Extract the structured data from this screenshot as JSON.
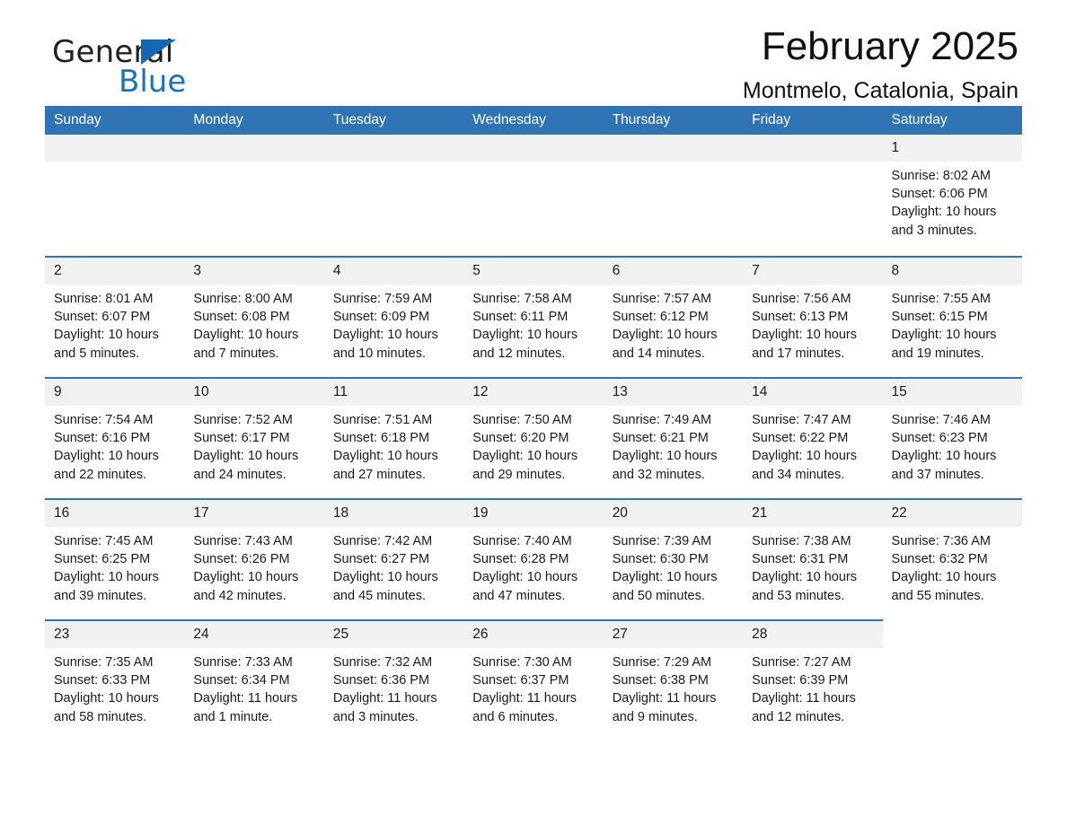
{
  "brand": {
    "name_part1": "General",
    "name_part2": "Blue"
  },
  "header": {
    "month_title": "February 2025",
    "location": "Montmelo, Catalonia, Spain"
  },
  "colors": {
    "header_blue": "#3174b6",
    "row_rule_blue": "#3174b6",
    "daynum_band": "#f1f1f1",
    "logo_blue": "#1473c4",
    "text": "#1a1a1a",
    "page_background": "#ffffff"
  },
  "calendar": {
    "weekday_headers": [
      "Sunday",
      "Monday",
      "Tuesday",
      "Wednesday",
      "Thursday",
      "Friday",
      "Saturday"
    ],
    "labels": {
      "sunrise_prefix": "Sunrise:",
      "sunset_prefix": "Sunset:",
      "daylight_prefix": "Daylight:"
    },
    "weeks": [
      [
        {
          "day": "",
          "empty": true
        },
        {
          "day": "",
          "empty": true
        },
        {
          "day": "",
          "empty": true
        },
        {
          "day": "",
          "empty": true
        },
        {
          "day": "",
          "empty": true
        },
        {
          "day": "",
          "empty": true
        },
        {
          "day": "1",
          "sunrise": "Sunrise: 8:02 AM",
          "sunset": "Sunset: 6:06 PM",
          "daylight": "Daylight: 10 hours and 3 minutes."
        }
      ],
      [
        {
          "day": "2",
          "sunrise": "Sunrise: 8:01 AM",
          "sunset": "Sunset: 6:07 PM",
          "daylight": "Daylight: 10 hours and 5 minutes."
        },
        {
          "day": "3",
          "sunrise": "Sunrise: 8:00 AM",
          "sunset": "Sunset: 6:08 PM",
          "daylight": "Daylight: 10 hours and 7 minutes."
        },
        {
          "day": "4",
          "sunrise": "Sunrise: 7:59 AM",
          "sunset": "Sunset: 6:09 PM",
          "daylight": "Daylight: 10 hours and 10 minutes."
        },
        {
          "day": "5",
          "sunrise": "Sunrise: 7:58 AM",
          "sunset": "Sunset: 6:11 PM",
          "daylight": "Daylight: 10 hours and 12 minutes."
        },
        {
          "day": "6",
          "sunrise": "Sunrise: 7:57 AM",
          "sunset": "Sunset: 6:12 PM",
          "daylight": "Daylight: 10 hours and 14 minutes."
        },
        {
          "day": "7",
          "sunrise": "Sunrise: 7:56 AM",
          "sunset": "Sunset: 6:13 PM",
          "daylight": "Daylight: 10 hours and 17 minutes."
        },
        {
          "day": "8",
          "sunrise": "Sunrise: 7:55 AM",
          "sunset": "Sunset: 6:15 PM",
          "daylight": "Daylight: 10 hours and 19 minutes."
        }
      ],
      [
        {
          "day": "9",
          "sunrise": "Sunrise: 7:54 AM",
          "sunset": "Sunset: 6:16 PM",
          "daylight": "Daylight: 10 hours and 22 minutes."
        },
        {
          "day": "10",
          "sunrise": "Sunrise: 7:52 AM",
          "sunset": "Sunset: 6:17 PM",
          "daylight": "Daylight: 10 hours and 24 minutes."
        },
        {
          "day": "11",
          "sunrise": "Sunrise: 7:51 AM",
          "sunset": "Sunset: 6:18 PM",
          "daylight": "Daylight: 10 hours and 27 minutes."
        },
        {
          "day": "12",
          "sunrise": "Sunrise: 7:50 AM",
          "sunset": "Sunset: 6:20 PM",
          "daylight": "Daylight: 10 hours and 29 minutes."
        },
        {
          "day": "13",
          "sunrise": "Sunrise: 7:49 AM",
          "sunset": "Sunset: 6:21 PM",
          "daylight": "Daylight: 10 hours and 32 minutes."
        },
        {
          "day": "14",
          "sunrise": "Sunrise: 7:47 AM",
          "sunset": "Sunset: 6:22 PM",
          "daylight": "Daylight: 10 hours and 34 minutes."
        },
        {
          "day": "15",
          "sunrise": "Sunrise: 7:46 AM",
          "sunset": "Sunset: 6:23 PM",
          "daylight": "Daylight: 10 hours and 37 minutes."
        }
      ],
      [
        {
          "day": "16",
          "sunrise": "Sunrise: 7:45 AM",
          "sunset": "Sunset: 6:25 PM",
          "daylight": "Daylight: 10 hours and 39 minutes."
        },
        {
          "day": "17",
          "sunrise": "Sunrise: 7:43 AM",
          "sunset": "Sunset: 6:26 PM",
          "daylight": "Daylight: 10 hours and 42 minutes."
        },
        {
          "day": "18",
          "sunrise": "Sunrise: 7:42 AM",
          "sunset": "Sunset: 6:27 PM",
          "daylight": "Daylight: 10 hours and 45 minutes."
        },
        {
          "day": "19",
          "sunrise": "Sunrise: 7:40 AM",
          "sunset": "Sunset: 6:28 PM",
          "daylight": "Daylight: 10 hours and 47 minutes."
        },
        {
          "day": "20",
          "sunrise": "Sunrise: 7:39 AM",
          "sunset": "Sunset: 6:30 PM",
          "daylight": "Daylight: 10 hours and 50 minutes."
        },
        {
          "day": "21",
          "sunrise": "Sunrise: 7:38 AM",
          "sunset": "Sunset: 6:31 PM",
          "daylight": "Daylight: 10 hours and 53 minutes."
        },
        {
          "day": "22",
          "sunrise": "Sunrise: 7:36 AM",
          "sunset": "Sunset: 6:32 PM",
          "daylight": "Daylight: 10 hours and 55 minutes."
        }
      ],
      [
        {
          "day": "23",
          "sunrise": "Sunrise: 7:35 AM",
          "sunset": "Sunset: 6:33 PM",
          "daylight": "Daylight: 10 hours and 58 minutes."
        },
        {
          "day": "24",
          "sunrise": "Sunrise: 7:33 AM",
          "sunset": "Sunset: 6:34 PM",
          "daylight": "Daylight: 11 hours and 1 minute."
        },
        {
          "day": "25",
          "sunrise": "Sunrise: 7:32 AM",
          "sunset": "Sunset: 6:36 PM",
          "daylight": "Daylight: 11 hours and 3 minutes."
        },
        {
          "day": "26",
          "sunrise": "Sunrise: 7:30 AM",
          "sunset": "Sunset: 6:37 PM",
          "daylight": "Daylight: 11 hours and 6 minutes."
        },
        {
          "day": "27",
          "sunrise": "Sunrise: 7:29 AM",
          "sunset": "Sunset: 6:38 PM",
          "daylight": "Daylight: 11 hours and 9 minutes."
        },
        {
          "day": "28",
          "sunrise": "Sunrise: 7:27 AM",
          "sunset": "Sunset: 6:39 PM",
          "daylight": "Daylight: 11 hours and 12 minutes."
        },
        {
          "day": "",
          "empty": true,
          "trailing": true
        }
      ]
    ]
  }
}
